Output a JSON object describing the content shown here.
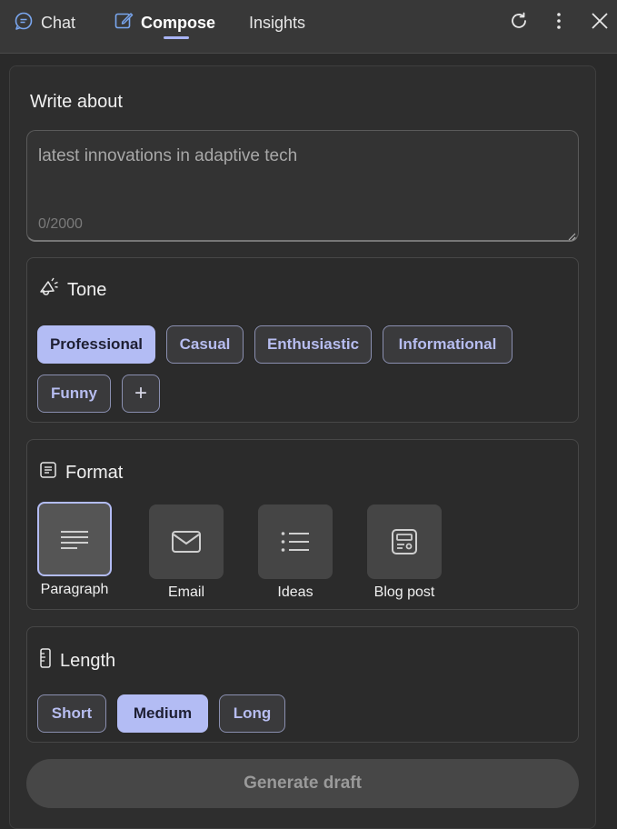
{
  "tabs": {
    "chat": "Chat",
    "compose": "Compose",
    "insights": "Insights"
  },
  "write": {
    "label": "Write about",
    "placeholder": "latest innovations in adaptive tech",
    "counter": "0/2000"
  },
  "tone": {
    "title": "Tone",
    "options": [
      "Professional",
      "Casual",
      "Enthusiastic",
      "Informational",
      "Funny"
    ],
    "selected": "Professional",
    "add": "+"
  },
  "format": {
    "title": "Format",
    "options": [
      "Paragraph",
      "Email",
      "Ideas",
      "Blog post"
    ],
    "selected": "Paragraph"
  },
  "length": {
    "title": "Length",
    "options": [
      "Short",
      "Medium",
      "Long"
    ],
    "selected": "Medium"
  },
  "generate": "Generate draft",
  "colors": {
    "accent": "#b3bcf4",
    "background": "#2a2a2a"
  }
}
